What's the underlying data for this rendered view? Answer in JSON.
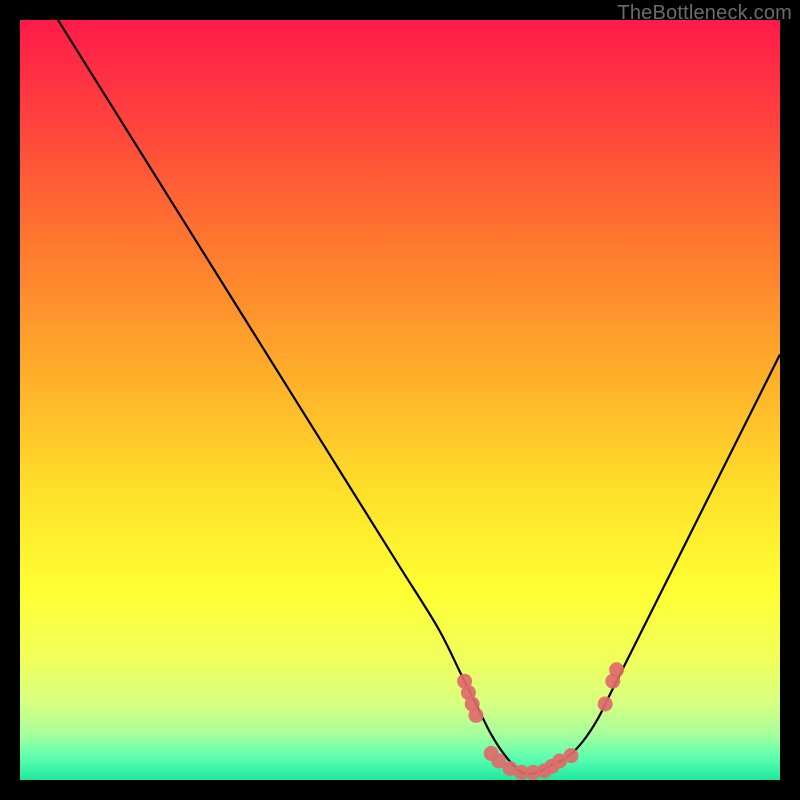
{
  "watermark": "TheBottleneck.com",
  "chart_data": {
    "type": "line",
    "title": "",
    "xlabel": "",
    "ylabel": "",
    "xlim": [
      0,
      100
    ],
    "ylim": [
      0,
      100
    ],
    "grid": false,
    "curve": {
      "description": "V-shaped bottleneck curve; minimum near x≈67",
      "x": [
        5,
        10,
        15,
        20,
        25,
        30,
        35,
        40,
        45,
        50,
        55,
        58,
        60,
        62,
        64,
        66,
        68,
        70,
        72,
        74,
        76,
        78,
        82,
        86,
        90,
        94,
        98,
        100
      ],
      "y": [
        100,
        92,
        84,
        76,
        68,
        60,
        52,
        44,
        36,
        28,
        20,
        14,
        10,
        6,
        3,
        1,
        1,
        2,
        3,
        5,
        8,
        12,
        20,
        28,
        36,
        44,
        52,
        56
      ]
    },
    "points": {
      "description": "Highlighted sample markers near the valley",
      "color": "#e06a6a",
      "x": [
        58.5,
        59.0,
        59.5,
        60.0,
        62.0,
        63.0,
        64.5,
        66.0,
        67.5,
        69.0,
        70.0,
        71.0,
        72.5,
        77.0,
        78.0,
        78.5
      ],
      "y": [
        13.0,
        11.5,
        10.0,
        8.5,
        3.5,
        2.5,
        1.5,
        1.0,
        1.0,
        1.2,
        1.8,
        2.5,
        3.2,
        10.0,
        13.0,
        14.5
      ]
    },
    "gradient_stops": [
      {
        "offset": 0.0,
        "color": "#ff1a4a"
      },
      {
        "offset": 0.12,
        "color": "#ff3e3e"
      },
      {
        "offset": 0.3,
        "color": "#ff7a2e"
      },
      {
        "offset": 0.48,
        "color": "#ffb22a"
      },
      {
        "offset": 0.62,
        "color": "#ffe02a"
      },
      {
        "offset": 0.75,
        "color": "#ffff33"
      },
      {
        "offset": 0.84,
        "color": "#f1ff5a"
      },
      {
        "offset": 0.9,
        "color": "#d6ff82"
      },
      {
        "offset": 0.94,
        "color": "#a6ff9c"
      },
      {
        "offset": 0.97,
        "color": "#5effb0"
      },
      {
        "offset": 1.0,
        "color": "#1de9a0"
      }
    ]
  }
}
